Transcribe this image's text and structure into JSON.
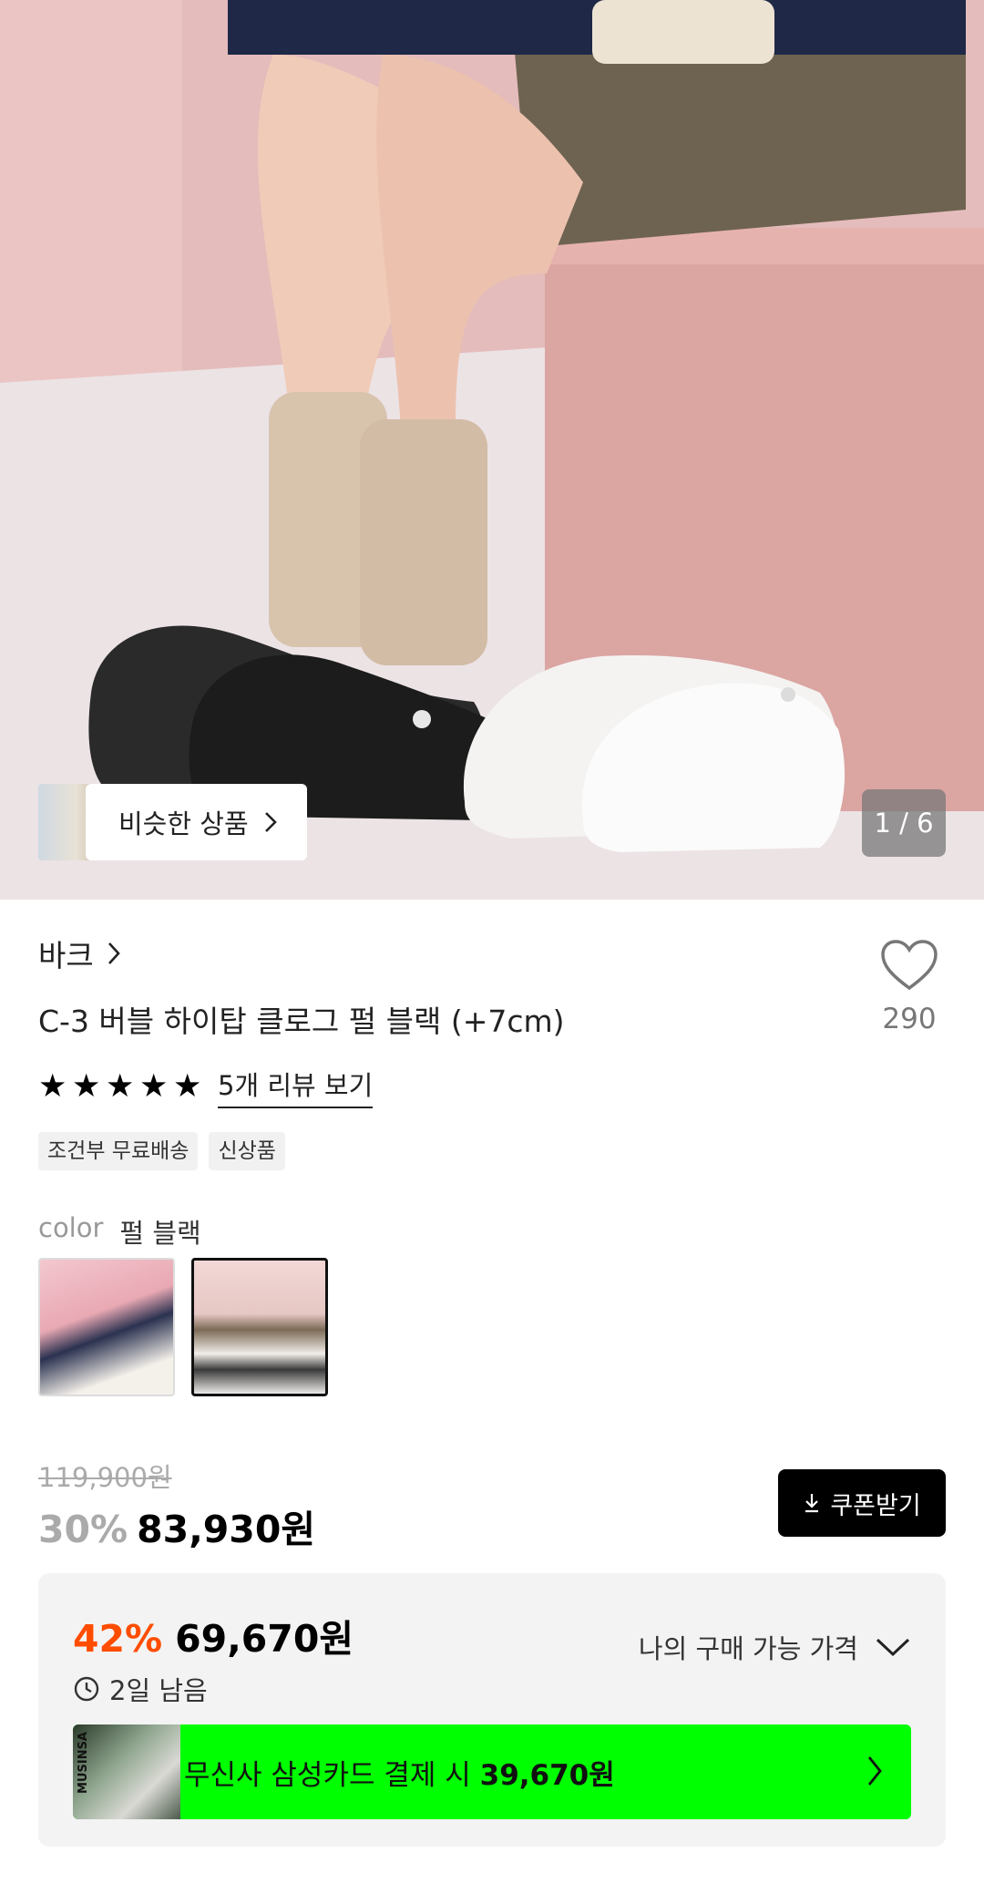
{
  "gallery": {
    "similar_label": "비슷한 상품",
    "counter": "1 / 6"
  },
  "product": {
    "brand": "바크",
    "title": "C-3 버블 하이탑 클로그 펄 블랙 (+7cm)",
    "like_count": "290",
    "review_link": "5개 리뷰 보기",
    "rating_stars": 5,
    "tags": [
      "조건부 무료배송",
      "신상품"
    ]
  },
  "options": {
    "color_label": "color",
    "color_value": "펄 블랙",
    "swatches": [
      "pink-background-swatch",
      "pearl-black-swatch"
    ],
    "selected_index": 1
  },
  "pricing": {
    "original_price": "119,900원",
    "discount_rate": "30%",
    "sale_price": "83,930원",
    "coupon_button": "쿠폰받기"
  },
  "benefit": {
    "best_discount": "42%",
    "best_price": "69,670원",
    "time_left": "2일 남음",
    "my_price_label": "나의 구매 가능 가격",
    "card_text": "무신사 삼성카드 결제 시 ",
    "card_price": "39,670원",
    "card_logo_text": "MUSINSA"
  },
  "colors": {
    "accent_orange": "#ff4d00",
    "card_green": "#00ff00",
    "button_black": "#000000"
  }
}
